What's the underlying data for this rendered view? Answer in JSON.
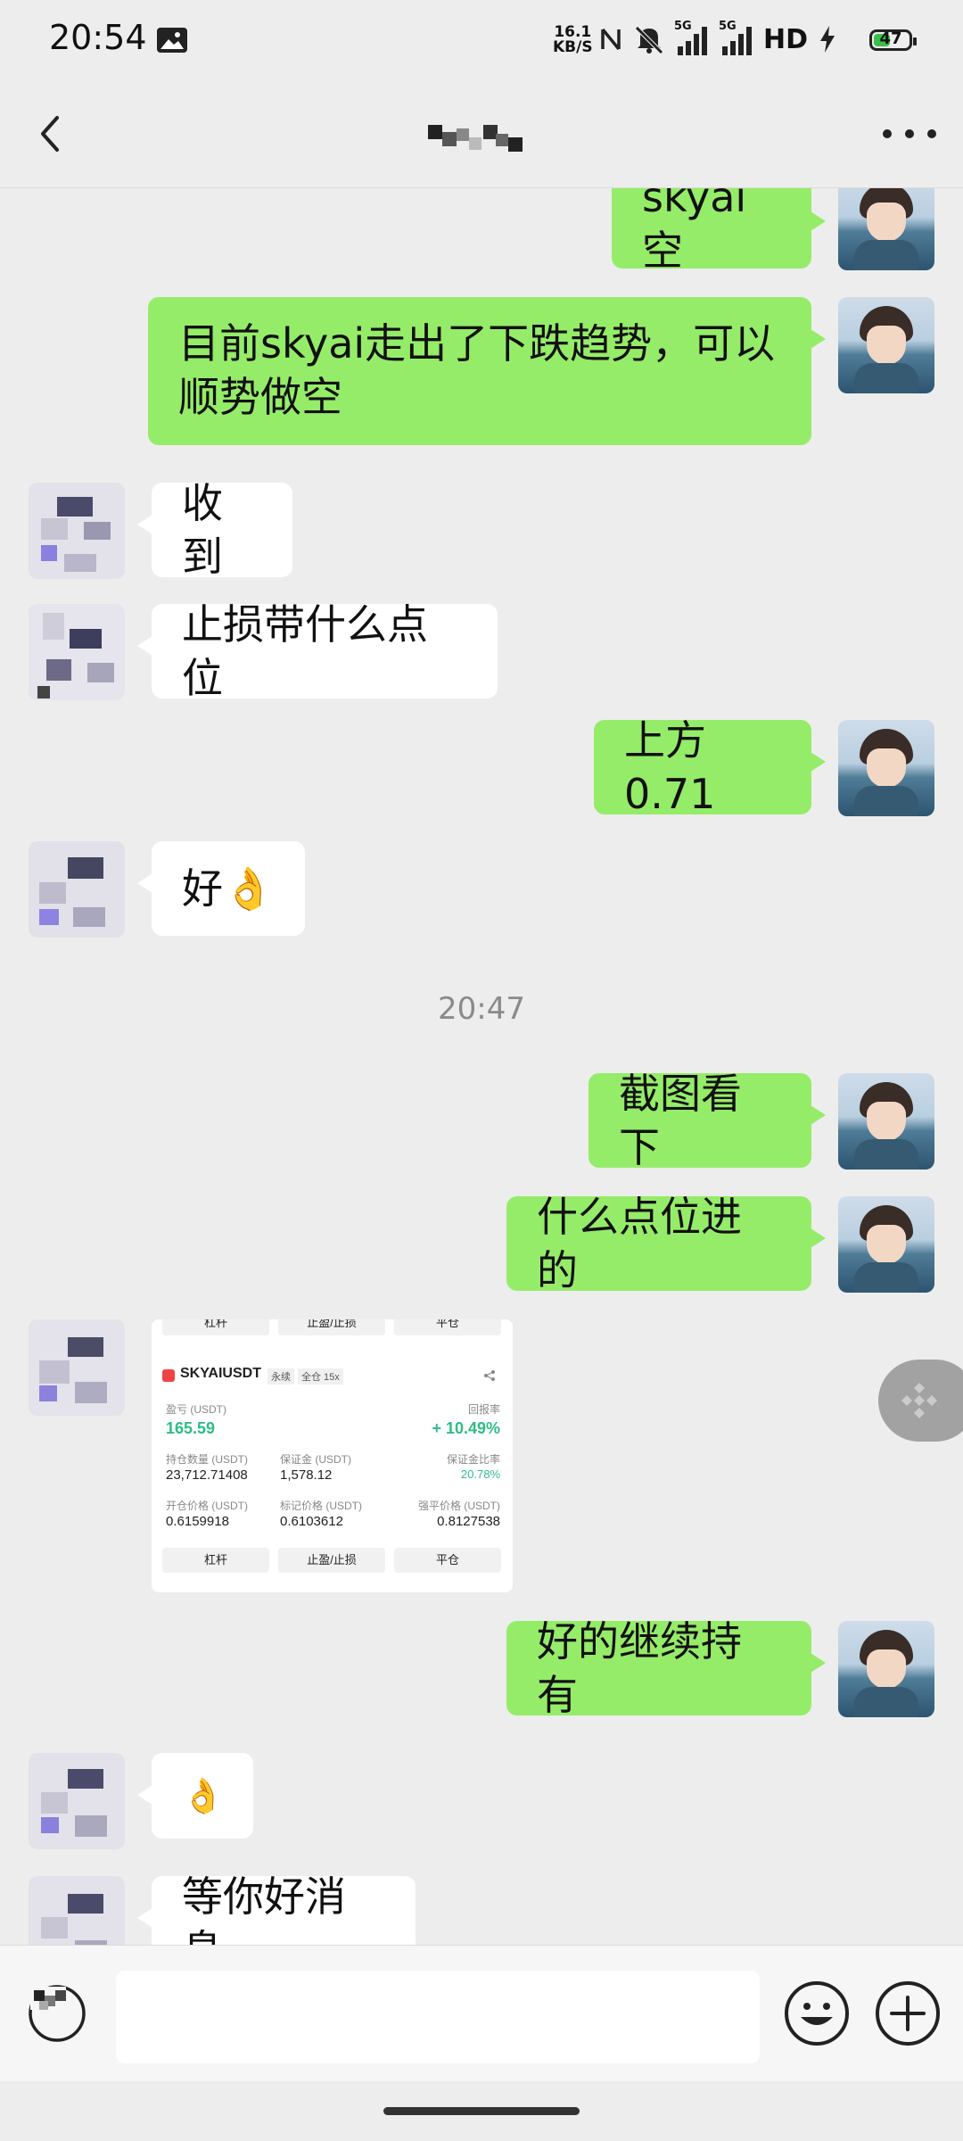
{
  "status_bar": {
    "time": "20:54",
    "net_speed_value": "16.1",
    "net_speed_unit": "KB/S",
    "signal_1": "5G",
    "signal_2": "5G",
    "hd": "HD",
    "battery": "47",
    "icons": [
      "gallery-icon",
      "nfc-icon",
      "mute-icon",
      "signal-icon",
      "signal-icon",
      "charging-icon"
    ]
  },
  "nav": {
    "back_icon": "chevron-left-icon",
    "more_icon": "more-dots-icon"
  },
  "messages": [
    {
      "side": "right",
      "text": "skyai空"
    },
    {
      "side": "right",
      "text": "目前skyai走出了下跌趋势，可以顺势做空",
      "lines": [
        "目前skyai走出了下跌趋势，可以",
        "顺势做空"
      ]
    },
    {
      "side": "left",
      "text": "收到"
    },
    {
      "side": "left",
      "text": "止损带什么点位"
    },
    {
      "side": "right",
      "text": "上方0.71"
    },
    {
      "side": "left",
      "text": "好👌"
    },
    {
      "type": "time",
      "text": "20:47"
    },
    {
      "side": "right",
      "text": "截图看下"
    },
    {
      "side": "right",
      "text": "什么点位进的"
    },
    {
      "side": "left",
      "type": "image"
    },
    {
      "side": "right",
      "text": "好的继续持有"
    },
    {
      "side": "left",
      "text": "👌"
    },
    {
      "side": "left",
      "text": "等你好消息"
    }
  ],
  "position_card": {
    "top_buttons": [
      "杠杆",
      "止盈/止损",
      "平仓"
    ],
    "symbol": "SKYAIUSDT",
    "contract_type": "永续",
    "margin_mode": "全仓 15x",
    "pnl_label": "盈亏 (USDT)",
    "pnl_value": "165.59",
    "roi_label": "回报率",
    "roi_value": "+ 10.49%",
    "size_label": "持仓数量 (USDT)",
    "size_value": "23,712.71408",
    "margin_label": "保证金 (USDT)",
    "margin_value": "1,578.12",
    "margin_ratio_label": "保证金比率",
    "margin_ratio_value": "20.78%",
    "entry_label": "开仓价格 (USDT)",
    "entry_value": "0.6159918",
    "mark_label": "标记价格 (USDT)",
    "mark_value": "0.6103612",
    "liq_label": "强平价格 (USDT)",
    "liq_value": "0.8127538",
    "bottom_buttons": [
      "杠杆",
      "止盈/止损",
      "平仓"
    ],
    "up_color": "#2ebd85"
  },
  "input_bar": {
    "placeholder": "",
    "voice_icon": "voice-icon",
    "emoji_icon": "emoji-icon",
    "plus_icon": "plus-icon"
  },
  "colors": {
    "sent_bubble": "#95ec69",
    "received_bubble": "#ffffff",
    "background": "#ededed"
  }
}
